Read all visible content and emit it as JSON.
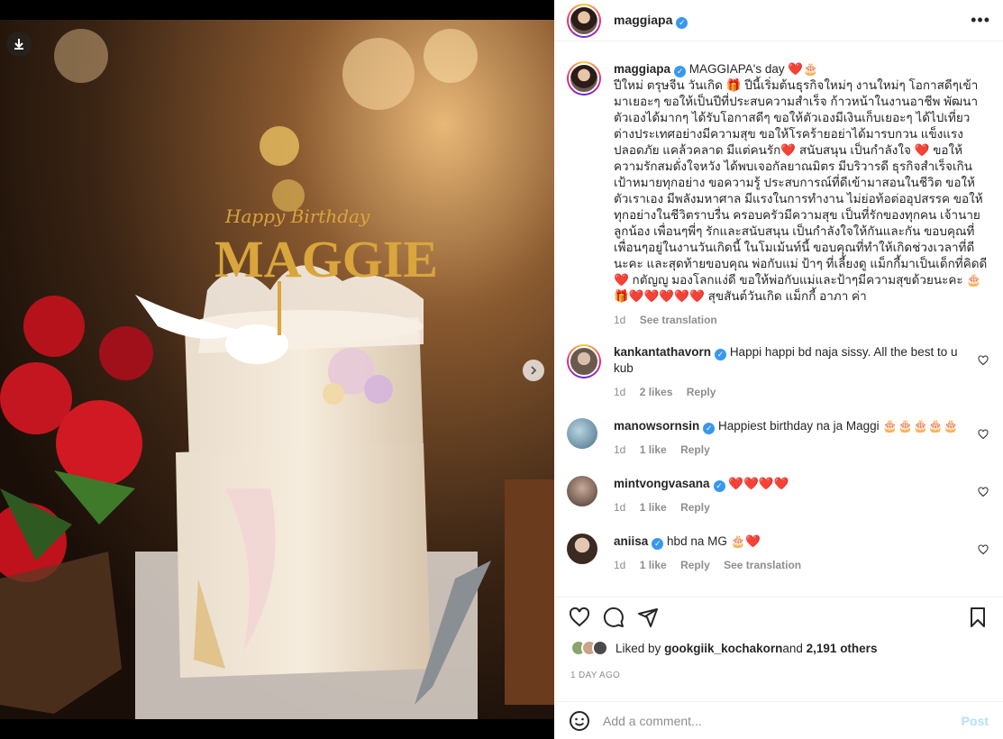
{
  "colors": {
    "verified": "#3897f0",
    "post_disabled": "#b2dffc",
    "meta": "#8e8e8e",
    "heart": "#e0245e"
  },
  "media": {
    "download_icon": "download-icon",
    "next_icon": "chevron-right-icon",
    "cake_topper_line1": "Happy Birthday",
    "cake_topper_line2": "MAGGIE"
  },
  "header": {
    "username": "maggiapa",
    "more_icon": "more-horizontal-icon"
  },
  "caption": {
    "username": "maggiapa",
    "first_line": "MAGGIAPA's day ❤️🎂",
    "text": "ปีใหม่ ตรุษจีน วันเกิด 🎁 ปีนี้เริ่มต้นธุรกิจใหม่ๆ งานใหม่ๆ โอกาสดีๆเข้ามาเยอะๆ ขอให้เป็นปีที่ประสบความสำเร็จ ก้าวหน้าในงานอาชีพ พัฒนาตัวเองได้มากๆ ได้รับโอกาสดีๆ ขอให้ตัวเองมีเงินเก็บเยอะๆ ได้ไปเที่ยวต่างประเทศอย่างมีความสุข ขอให้โรคร้ายอย่าได้มารบกวน แข็งแรง ปลอดภัย แคล้วคลาด มีแต่คนรัก❤️ สนับสนุน เป็นกำลังใจ ❤️ ขอให้ความรักสมดั่งใจหวัง ได้พบเจอกัลยาณมิตร มีบริวารดี ธุรกิจสำเร็จเกินเป้าหมายทุกอย่าง ขอความรู้ ประสบการณ์ที่ดีเข้ามาสอนในชีวิต ขอให้ตัวเราเอง มีพลังมหาศาล มีแรงในการทำงาน ไม่ย่อท้อต่ออุปสรรค ขอให้ทุกอย่างในชีวิตราบรื่น ครอบครัวมีความสุข เป็นที่รักของทุกคน เจ้านาย ลูกน้อง เพื่อนๆพี่ๆ รักและสนับสนุน เป็นกำลังใจให้กันและกัน ขอบคุณที่เพื่อนๆอยู่ในงานวันเกิดนี้ ในโมเม้นท์นี้ ขอบคุณที่ทำให้เกิดช่วงเวลาที่ดีนะคะ และสุดท้ายขอบคุณ พ่อกับแม่ ป้าๆ ที่เลี้ยงดู แม็กกี้มาเป็นเด็กที่คิดดี ❤️ กตัญญู มองโลกแง่ดี ขอให้พ่อกับแม่และป้าๆมีความสุขด้วยนะคะ 🎂🎁❤️❤️❤️❤️❤️ สุขสันต์วันเกิด แม็กกี้ อาภา ค่า",
    "age": "1d",
    "see_translation": "See translation"
  },
  "comments": [
    {
      "username": "kankantathavorn",
      "verified": true,
      "text": "Happi happi bd naja sissy. All the best to u kub",
      "age": "1d",
      "likes": "2 likes",
      "reply": "Reply",
      "translation": ""
    },
    {
      "username": "manowsornsin",
      "verified": true,
      "text": "Happiest birthday na ja Maggi 🎂🎂🎂🎂🎂",
      "age": "1d",
      "likes": "1 like",
      "reply": "Reply",
      "translation": ""
    },
    {
      "username": "mintvongvasana",
      "verified": true,
      "text": "❤️❤️❤️❤️",
      "age": "1d",
      "likes": "1 like",
      "reply": "Reply",
      "translation": ""
    },
    {
      "username": "aniisa",
      "verified": true,
      "text": "hbd na MG 🎂❤️",
      "age": "1d",
      "likes": "1 like",
      "reply": "Reply",
      "translation": "See translation"
    }
  ],
  "actions": {
    "like_icon": "heart-icon",
    "comment_icon": "comment-icon",
    "share_icon": "share-icon",
    "save_icon": "bookmark-icon"
  },
  "likes": {
    "prefix": "Liked by ",
    "user": "gookgiik_kochakorn",
    "and": " and ",
    "others": "2,191 others"
  },
  "time_ago": "1 DAY AGO",
  "add_comment": {
    "placeholder": "Add a comment...",
    "post_label": "Post",
    "emoji_icon": "smile-icon"
  }
}
